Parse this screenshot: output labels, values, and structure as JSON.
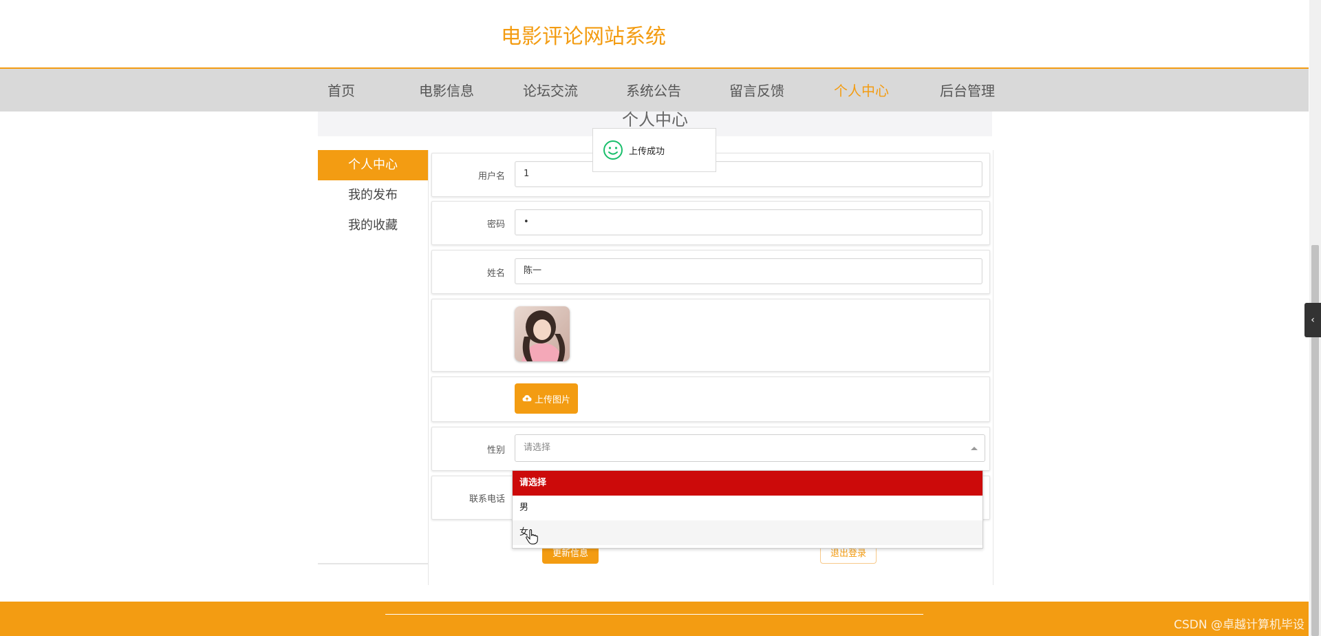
{
  "header": {
    "title": "电影评论网站系统"
  },
  "nav": {
    "items": [
      {
        "label": "首页",
        "active": false
      },
      {
        "label": "电影信息",
        "active": false
      },
      {
        "label": "论坛交流",
        "active": false
      },
      {
        "label": "系统公告",
        "active": false
      },
      {
        "label": "留言反馈",
        "active": false
      },
      {
        "label": "个人中心",
        "active": true
      },
      {
        "label": "后台管理",
        "active": false
      }
    ]
  },
  "section": {
    "title": "个人中心"
  },
  "left_menu": {
    "items": [
      {
        "label": "个人中心",
        "active": true
      },
      {
        "label": "我的发布",
        "active": false
      },
      {
        "label": "我的收藏",
        "active": false
      }
    ]
  },
  "form": {
    "username_label": "用户名",
    "username_value": "1",
    "password_label": "密码",
    "password_value": "•",
    "name_label": "姓名",
    "name_value": "陈一",
    "upload_button_label": "上传图片",
    "gender_label": "性别",
    "gender_value": "请选择",
    "gender_options": [
      "请选择",
      "男",
      "女"
    ],
    "phone_label": "联系电话",
    "update_button_label": "更新信息",
    "logout_button_label": "退出登录"
  },
  "toast": {
    "message": "上传成功",
    "icon": "smile-icon"
  },
  "watermark": "CSDN @卓越计算机毕设",
  "colors": {
    "accent": "#f39c12",
    "selected_option": "#cc0a0a",
    "toast_icon": "#19be6b"
  }
}
